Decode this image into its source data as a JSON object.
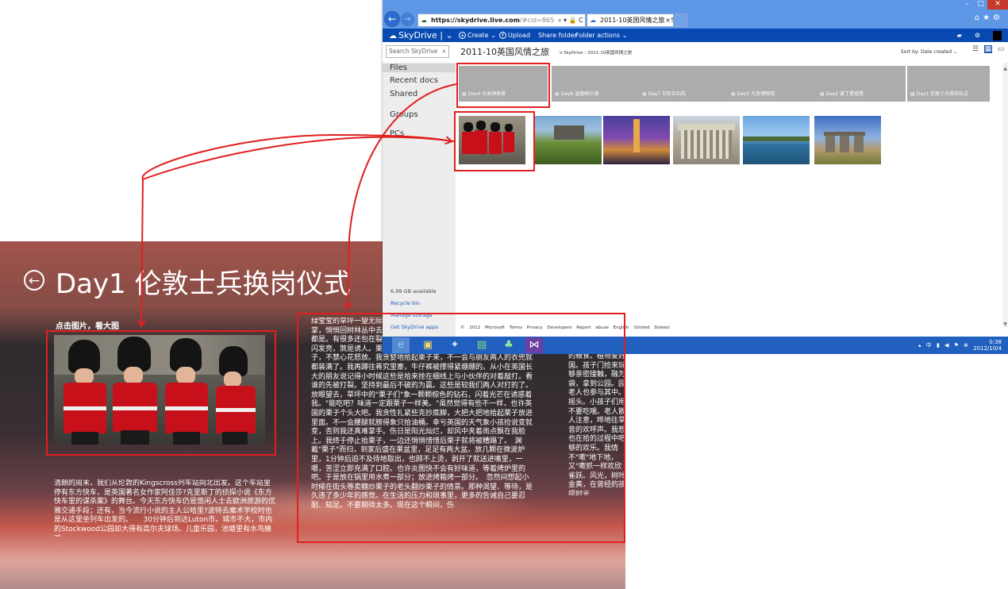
{
  "metro_app": {
    "title": "Day1 伦敦士兵换岗仪式",
    "hint": "点击图片，看大图",
    "body_text_1": "清朗的周末，我们从伦敦的Kingscross列车站向北出发。这个车站里停有东方快车，是英国著名女作家阿佳莎?克里斯丁的侦探小说《东方快车里的谋杀案》的舞台。今天东方快车仍是悠闲人士去欧洲旅游的优雅交通手段；还有，当今流行小说的主人公哈里?波特去魔术学校时也是从这里坐列车出发的。　　30分钟后到达Luton市。城市不大，市内的Stockwood公园却大得有高尔夫球场。儿童乐园，池塘里有水鸟嬉戏，",
    "body_text_2": "绿莹莹的草坪一望无际，热的公园平添盎然生机。么，用两只脚爪捧在掌，悄悄回树林丛中去了。子般的坚果，比栗子稍大。坏脑四周，遍地都是。有很多还包在裂开一半的密在尖刺刺缠的外壳里，棕色的光泽闪闪发亮，煞是诱人。栗子是我的最喜欢的食品之一。今天看见满地栗子，不禁心花怒放。我贪婪地拾起栗子来，不一会与朋友两人的衣兜就都装满了。我再蹲往蒋究里寨，牛仔裤被撑得紧绷绷的。从小在英国长大的朋友说记得小时候这些是拾来拴在细线上与小伙伴的对着敲打。看谁的先被打裂。坚持到最后不破的为赢。这些是较我们两人对打的了。　放眼望去，草坪中的\"栗子们\"象一颗颗棕色的钻石，闪着光芒在诱惑着我。\"能吃吧？味道一定跟栗子一样美。\"虽然觉得有些不一样，也许英国的栗子个头大吧。我贪性扎紧些克抄底脚，大把大把地拾起栗子放进里面。不一会腰腿就膀得象只拾油桶。幸亏英国的天气象小孩捡说变就变，否则我还真难掌手。伤日是阳光灿烂，却风中夹着雨点飘在我脸上。我终于停止拾栗子，一边还悄悄惜惜后栗子就将被糟蹋了。　渊戴\"栗子\"而归，到家后盛在果盆里，足足有两大盆。放几颗在微波炉里，1分钟后迫不及待地取出，也顾不上烫，剥开了就送进嘴里，一嚼，苦涩立即充满了口腔。也许炎图快不会有好味道，等着烤炉里的吧。于是放在锅里用水煮一部分；放进烤箱烤一部分。　忽然间想起小时候在街头等卖糖炒栗子的老头翻炒栗子的情景。那种渴望、等待，是久违了多少年的感觉。在生活的压力和琐事里，更多的告诫自己要忍耐、知足。不要期待太多。现在这个瞬间，伤",
    "body_text_3": "的粮食。植物爱好国。孩子门捡来玩够亲密接触，融为袋，拿到公园。园老人也参与其中。摇头。小孩子们用不要吃哦。老人散人注意，哗地往草音的欢呼声。我想也在拾的过程中吧够的欢乐。我情不\"嗽\"地下地，又\"嗽抓一样欢欣雀跃。风光，树叶金黄，在曾经的孩提时光"
  },
  "browser": {
    "url_host": "https://skydrive.live.com",
    "url_rest": "/#cid=865665823C96/",
    "tab_title": "2011-10英国风情之旅 - Sk...",
    "window_controls": [
      "–",
      "□",
      "✕"
    ]
  },
  "skydrive": {
    "brand": "SkyDrive",
    "commands": [
      "Create ⌄",
      "Upload",
      "Share folder",
      "Folder actions ⌄"
    ],
    "search_placeholder": "Search SkyDrive",
    "nav": [
      "Files",
      "Recent docs",
      "Shared",
      "Groups",
      "PCs"
    ],
    "available": "6.99 GB available",
    "recycle": "Recycle bin",
    "manage": "Manage storage",
    "get_apps": "Get SkyDrive apps",
    "folder_title": "2011-10英国风情之旅",
    "breadcrumb": "'s SkyDrive › 2011-10英国风情之旅",
    "sort_label": "Sort by: Date created ⌄",
    "folders": [
      "Day4 大本钟夜景",
      "Day6 温德梅尔湖",
      "Day7 巨形巨石阵",
      "Day5 大英博物馆",
      "Day2 爱丁堡城堡",
      "Day1 伦敦士兵换岗仪式"
    ],
    "footer": "© 2012 Microsoft   Terms   Privacy   Developers   Report abuse   English (United States)"
  },
  "taskbar": {
    "time": "0:38",
    "date": "2012/10/4",
    "tray_icons": "▴ 中 ▮ ◀ ⚑ ⊗"
  },
  "colors": {
    "annotation_red": "#e11f1f",
    "skydrive_blue": "#094ab2",
    "chrome_blue": "#5f97e7",
    "taskbar_blue": "#2160bf"
  }
}
